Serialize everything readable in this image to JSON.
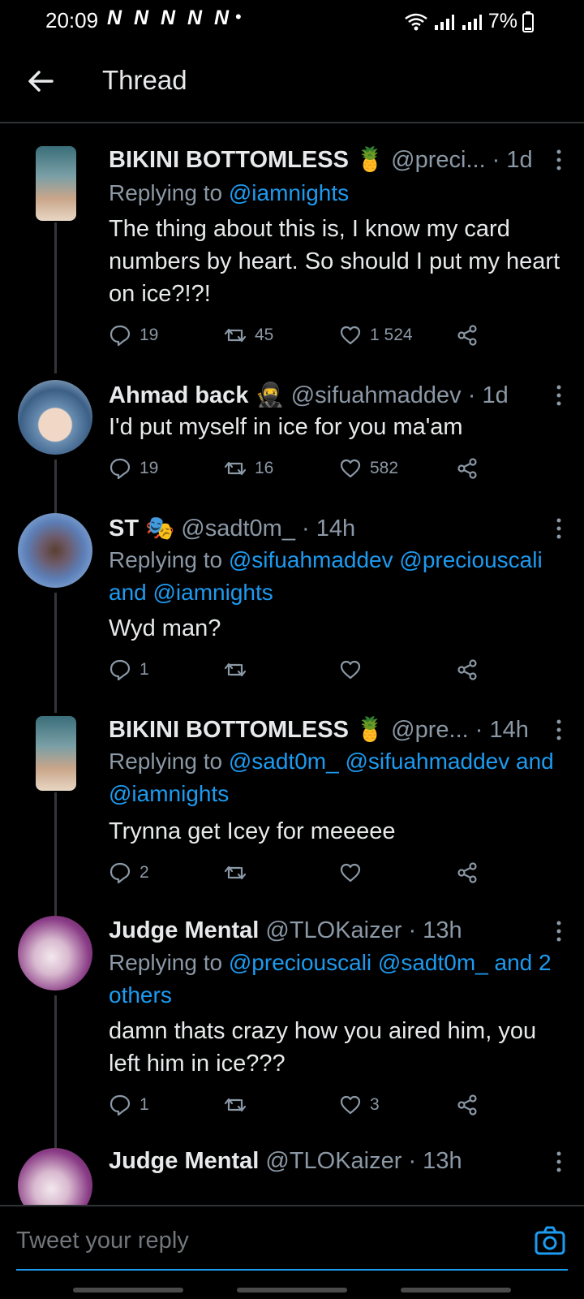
{
  "status": {
    "time": "20:09",
    "notifs": "N N N N N",
    "dot": "•",
    "battery": "7%"
  },
  "header": {
    "title": "Thread"
  },
  "tweets": [
    {
      "name": "BIKINI BOTTOMLESS",
      "emoji": "🍍",
      "handle": "@preci... · 1d",
      "reply_prefix": "Replying to ",
      "reply_links": "@iamnights",
      "text": "The thing about this is, I know my card numbers by heart. So should I put my heart on ice?!?!",
      "replies": "19",
      "retweets": "45",
      "likes": "1 524"
    },
    {
      "name": "Ahmad back",
      "emoji": "🥷",
      "handle": "@sifuahmaddev · 1d",
      "text": "I'd put myself in ice for you ma'am",
      "replies": "19",
      "retweets": "16",
      "likes": "582"
    },
    {
      "name": "ST",
      "emoji": "🎭",
      "handle": "@sadt0m_ · 14h",
      "reply_prefix": "Replying to ",
      "reply_links": "@sifuahmaddev @preciouscali and @iamnights",
      "text": "Wyd man?",
      "replies": "1",
      "retweets": "",
      "likes": ""
    },
    {
      "name": "BIKINI BOTTOMLESS",
      "emoji": "🍍",
      "handle": "@pre... · 14h",
      "reply_prefix": "Replying to ",
      "reply_links": "@sadt0m_ @sifuahmaddev and @iamnights",
      "text": "Trynna get Icey for meeeee",
      "replies": "2",
      "retweets": "",
      "likes": ""
    },
    {
      "name": "Judge Mental",
      "emoji": "",
      "handle": "@TLOKaizer · 13h",
      "reply_prefix": "Replying to ",
      "reply_links": "@preciouscali @sadt0m_ and 2 others",
      "text": "damn thats crazy how you aired him, you left him in ice???",
      "replies": "1",
      "retweets": "",
      "likes": "3"
    },
    {
      "name": "Judge Mental",
      "emoji": "",
      "handle": "@TLOKaizer · 13h"
    }
  ],
  "composer": {
    "placeholder": "Tweet your reply"
  },
  "colors": {
    "accent": "#1d9bf0",
    "muted": "#8b98a5",
    "bg": "#000000"
  },
  "icons": [
    "arrow-left-icon",
    "reply-icon",
    "retweet-icon",
    "like-icon",
    "share-icon",
    "more-icon",
    "camera-icon"
  ]
}
